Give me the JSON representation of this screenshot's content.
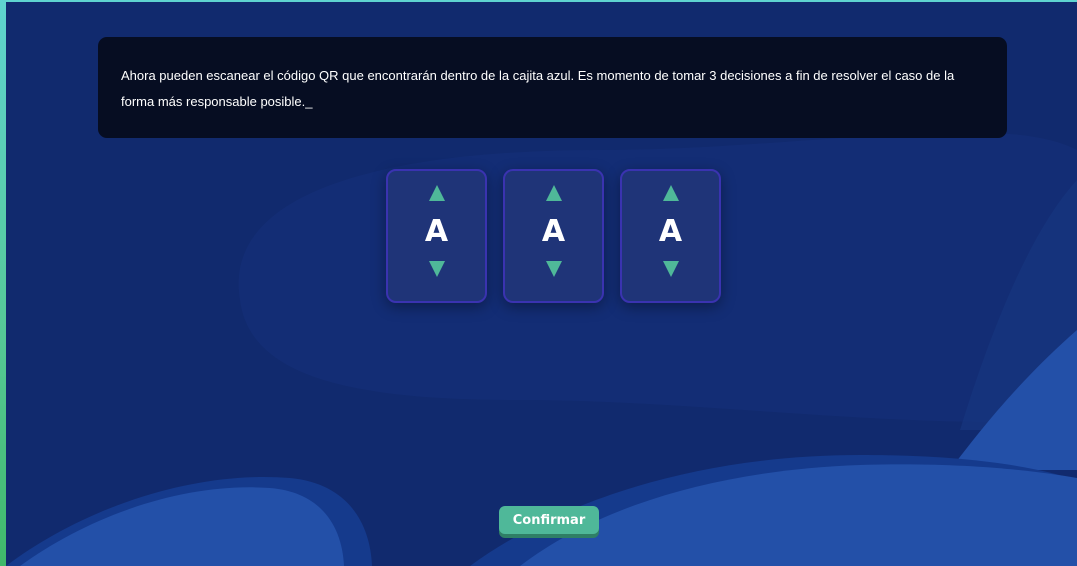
{
  "dialog": {
    "text": "Ahora pueden escanear el código QR que encontrarán dentro de la cajita azul. Es momento de tomar 3 decisiones a fin de resolver el caso de la forma más responsable posible._"
  },
  "selectors": [
    {
      "value": "A",
      "up_icon": "triangle-up",
      "down_icon": "triangle-down"
    },
    {
      "value": "A",
      "up_icon": "triangle-up",
      "down_icon": "triangle-down"
    },
    {
      "value": "A",
      "up_icon": "triangle-up",
      "down_icon": "triangle-down"
    }
  ],
  "confirm_button": {
    "label": "Confirmar"
  },
  "colors": {
    "background": "#112a6e",
    "dialog_background": "#060d22",
    "accent_green": "#4fb899",
    "selector_border": "#3a33b0",
    "wave_light": "#2350a8"
  }
}
